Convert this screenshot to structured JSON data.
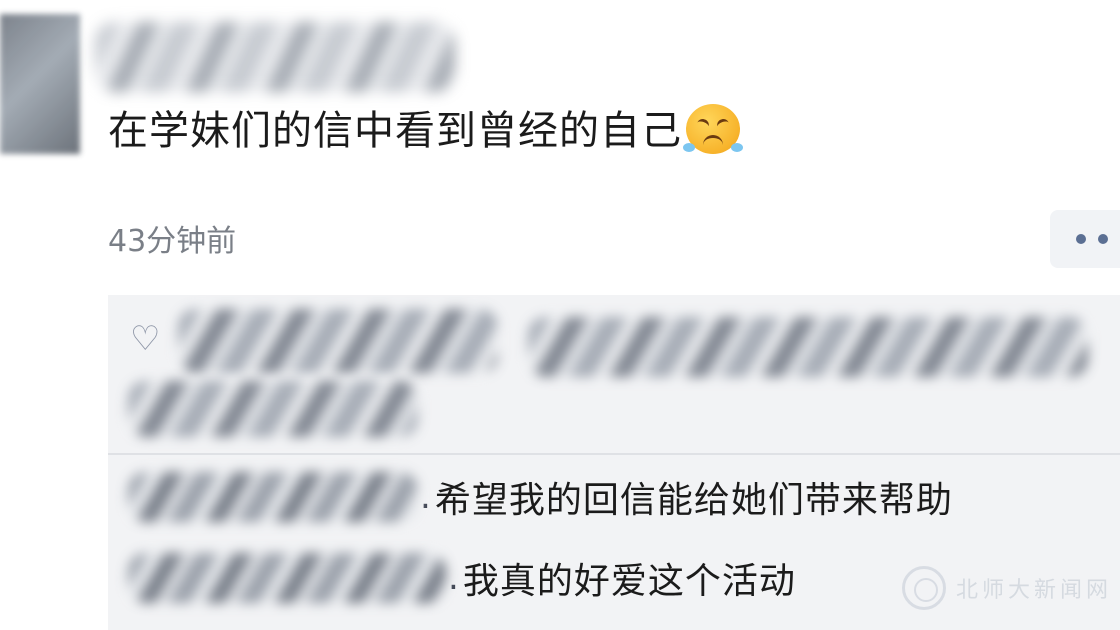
{
  "post": {
    "text": "在学妹们的信中看到曾经的自己",
    "emoji_icon": "crying-laughing-face-icon",
    "timestamp": "43分钟前"
  },
  "actions": {
    "more_icon": "more-dots-icon"
  },
  "likes": {
    "icon": "heart-icon"
  },
  "comments": [
    {
      "separator": ".",
      "text": "希望我的回信能给她们带来帮助"
    },
    {
      "separator": ".",
      "text": "我真的好爱这个活动"
    }
  ],
  "watermark": {
    "text": "北师大新闻网",
    "icon": "university-seal-icon"
  }
}
